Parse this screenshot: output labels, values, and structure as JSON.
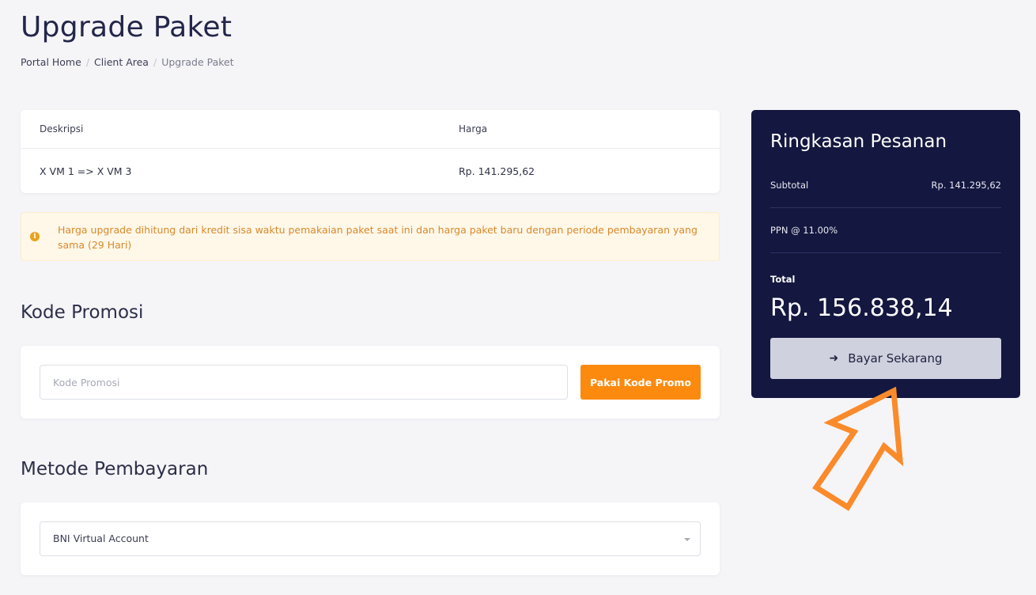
{
  "page": {
    "title": "Upgrade Paket",
    "breadcrumb": [
      "Portal Home",
      "Client Area",
      "Upgrade Paket"
    ]
  },
  "table": {
    "headers": [
      "Deskripsi",
      "Harga"
    ],
    "rows": [
      {
        "desc": "X VM 1 => X VM 3",
        "price": "Rp. 141.295,62"
      }
    ]
  },
  "alert": {
    "icon": "info-icon",
    "text": "Harga upgrade dihitung dari kredit sisa waktu pemakaian paket saat ini dan harga paket baru dengan periode pembayaran yang sama (29 Hari)"
  },
  "promo": {
    "section_title": "Kode Promosi",
    "placeholder": "Kode Promosi",
    "button_label": "Pakai Kode Promo"
  },
  "payment": {
    "section_title": "Metode Pembayaran",
    "selected": "BNI Virtual Account"
  },
  "summary": {
    "title": "Ringkasan Pesanan",
    "subtotal_label": "Subtotal",
    "subtotal_value": "Rp. 141.295,62",
    "ppn_label": "PPN @ 11.00%",
    "total_label": "Total",
    "total_value": "Rp. 156.838,14",
    "pay_button": "Bayar Sekarang"
  },
  "colors": {
    "accent_orange": "#fb8a0f",
    "summary_bg": "#14173f",
    "alert_text": "#d9882a",
    "callout_arrow": "#fb8a2a"
  }
}
